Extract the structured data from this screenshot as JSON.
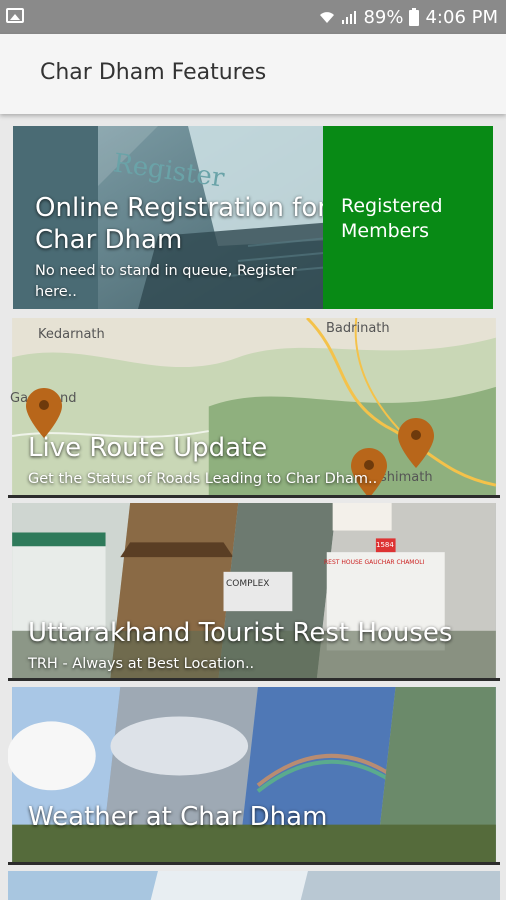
{
  "status_bar": {
    "battery_percent": "89%",
    "time": "4:06 PM",
    "icons": [
      "image-icon",
      "wifi-icon",
      "signal-icon",
      "battery-icon"
    ]
  },
  "app_bar": {
    "title": "Char Dham Features"
  },
  "cards": [
    {
      "title_line1": "Online Registration for",
      "title_line2": "Char Dham",
      "subtitle_line1": "No need to stand in queue, Register",
      "subtitle_line2": "here..",
      "side_button_line1": "Registered",
      "side_button_line2": "Members",
      "image_text": "Register"
    },
    {
      "title": "Live Route Update",
      "subtitle": "Get the Status of Roads Leading to Char Dham..",
      "map_labels": [
        "Kedarnath",
        "Badrinath",
        "Ga",
        "nd",
        "shimath"
      ]
    },
    {
      "title": "Uttarakhand Tourist Rest Houses",
      "subtitle": "TRH - Always at Best Location..",
      "sign_texts": [
        "COMPLEX",
        "REST HOUSE GAUCHAR CHAMOLI",
        "1584"
      ]
    },
    {
      "title": "Weather at Char Dham"
    },
    {}
  ],
  "colors": {
    "status_bar": "#8a8a8a",
    "app_bar": "#f5f5f5",
    "registered_panel": "#088a15",
    "pin": "#b8661a"
  }
}
